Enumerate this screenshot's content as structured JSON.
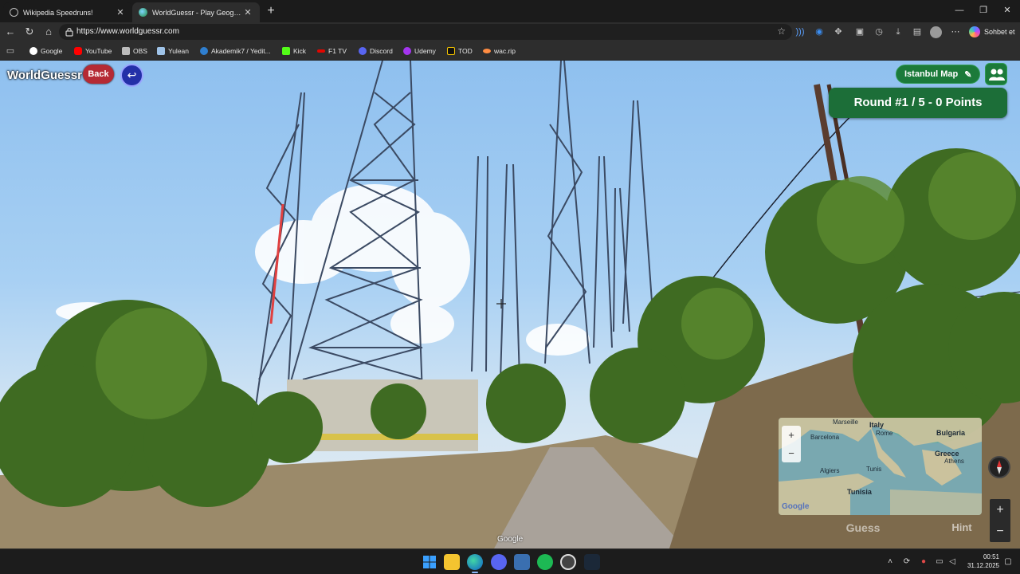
{
  "browser": {
    "tabs": [
      {
        "title": "Wikipedia Speedruns!",
        "active": false
      },
      {
        "title": "WorldGuessr - Play Geoguessr for Free",
        "active": true
      }
    ],
    "url": "https://www.worldguessr.com",
    "new_tab_glyph": "+",
    "window_controls": [
      "—",
      "❐",
      "✕"
    ],
    "copilot_label": "Sohbet et",
    "bookmarks": [
      {
        "label": "Google",
        "color": "#4285f4"
      },
      {
        "label": "YouTube",
        "color": "#ff0000"
      },
      {
        "label": "OBS",
        "color": "#bbbbbb"
      },
      {
        "label": "Yulean",
        "color": "#9fc3e8"
      },
      {
        "label": "Akademik7 / Yedit...",
        "color": "#2f7fd0"
      },
      {
        "label": "Kick",
        "color": "#53fc18"
      },
      {
        "label": "F1 TV",
        "color": "#e10600"
      },
      {
        "label": "Discord",
        "color": "#5865f2"
      },
      {
        "label": "Udemy",
        "color": "#a435f0"
      },
      {
        "label": "TOD",
        "color": "#111111"
      },
      {
        "label": "wac.rip",
        "color": "#ff8c42"
      }
    ]
  },
  "game": {
    "brand": "WorldGuessr",
    "back_label": "Back",
    "undo_glyph": "↩",
    "map_name": "Istanbul Map",
    "edit_glyph": "✎",
    "round_text": "Round #1 / 5 - 0 Points",
    "guess_label": "Guess",
    "hint_label": "Hint",
    "zoom_in": "+",
    "zoom_out": "−",
    "watermark": "Google",
    "minimap": {
      "labels": [
        "Marseille",
        "Italy",
        "Rome",
        "Bulgaria",
        "Barcelona",
        "Greece",
        "Athens",
        "Algiers",
        "Tunis",
        "Tunisia"
      ],
      "zoom_in": "+",
      "zoom_out": "−",
      "attribution": "Google"
    }
  },
  "taskbar": {
    "apps": [
      "start",
      "file-explorer",
      "edge",
      "discord",
      "snipping",
      "spotify",
      "obs",
      "steam"
    ],
    "time": "00:51",
    "date": "31.12.2025"
  },
  "colors": {
    "accent_green": "#1b7a3a",
    "back_red": "#b52a34",
    "undo_blue": "#2430a8"
  }
}
